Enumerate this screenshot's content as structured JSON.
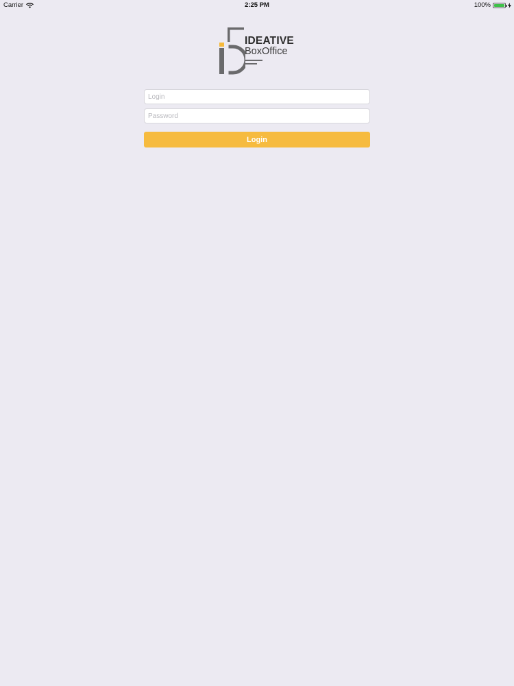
{
  "status_bar": {
    "carrier": "Carrier",
    "time": "2:25 PM",
    "battery_percent_label": "100%",
    "battery_level": 1.0,
    "icons": [
      "wifi-icon",
      "battery-icon",
      "charging-icon"
    ]
  },
  "logo": {
    "line1": "IDEATIVE",
    "line2": "BoxOffice",
    "colors": {
      "mark": "#6a6a6c",
      "accent": "#f6b93b"
    }
  },
  "form": {
    "login_placeholder": "Login",
    "login_value": "",
    "password_placeholder": "Password",
    "password_value": "",
    "submit_label": "Login"
  },
  "colors": {
    "background": "#eceaf2",
    "button": "#f6bb3f",
    "button_text": "#ffffff"
  }
}
